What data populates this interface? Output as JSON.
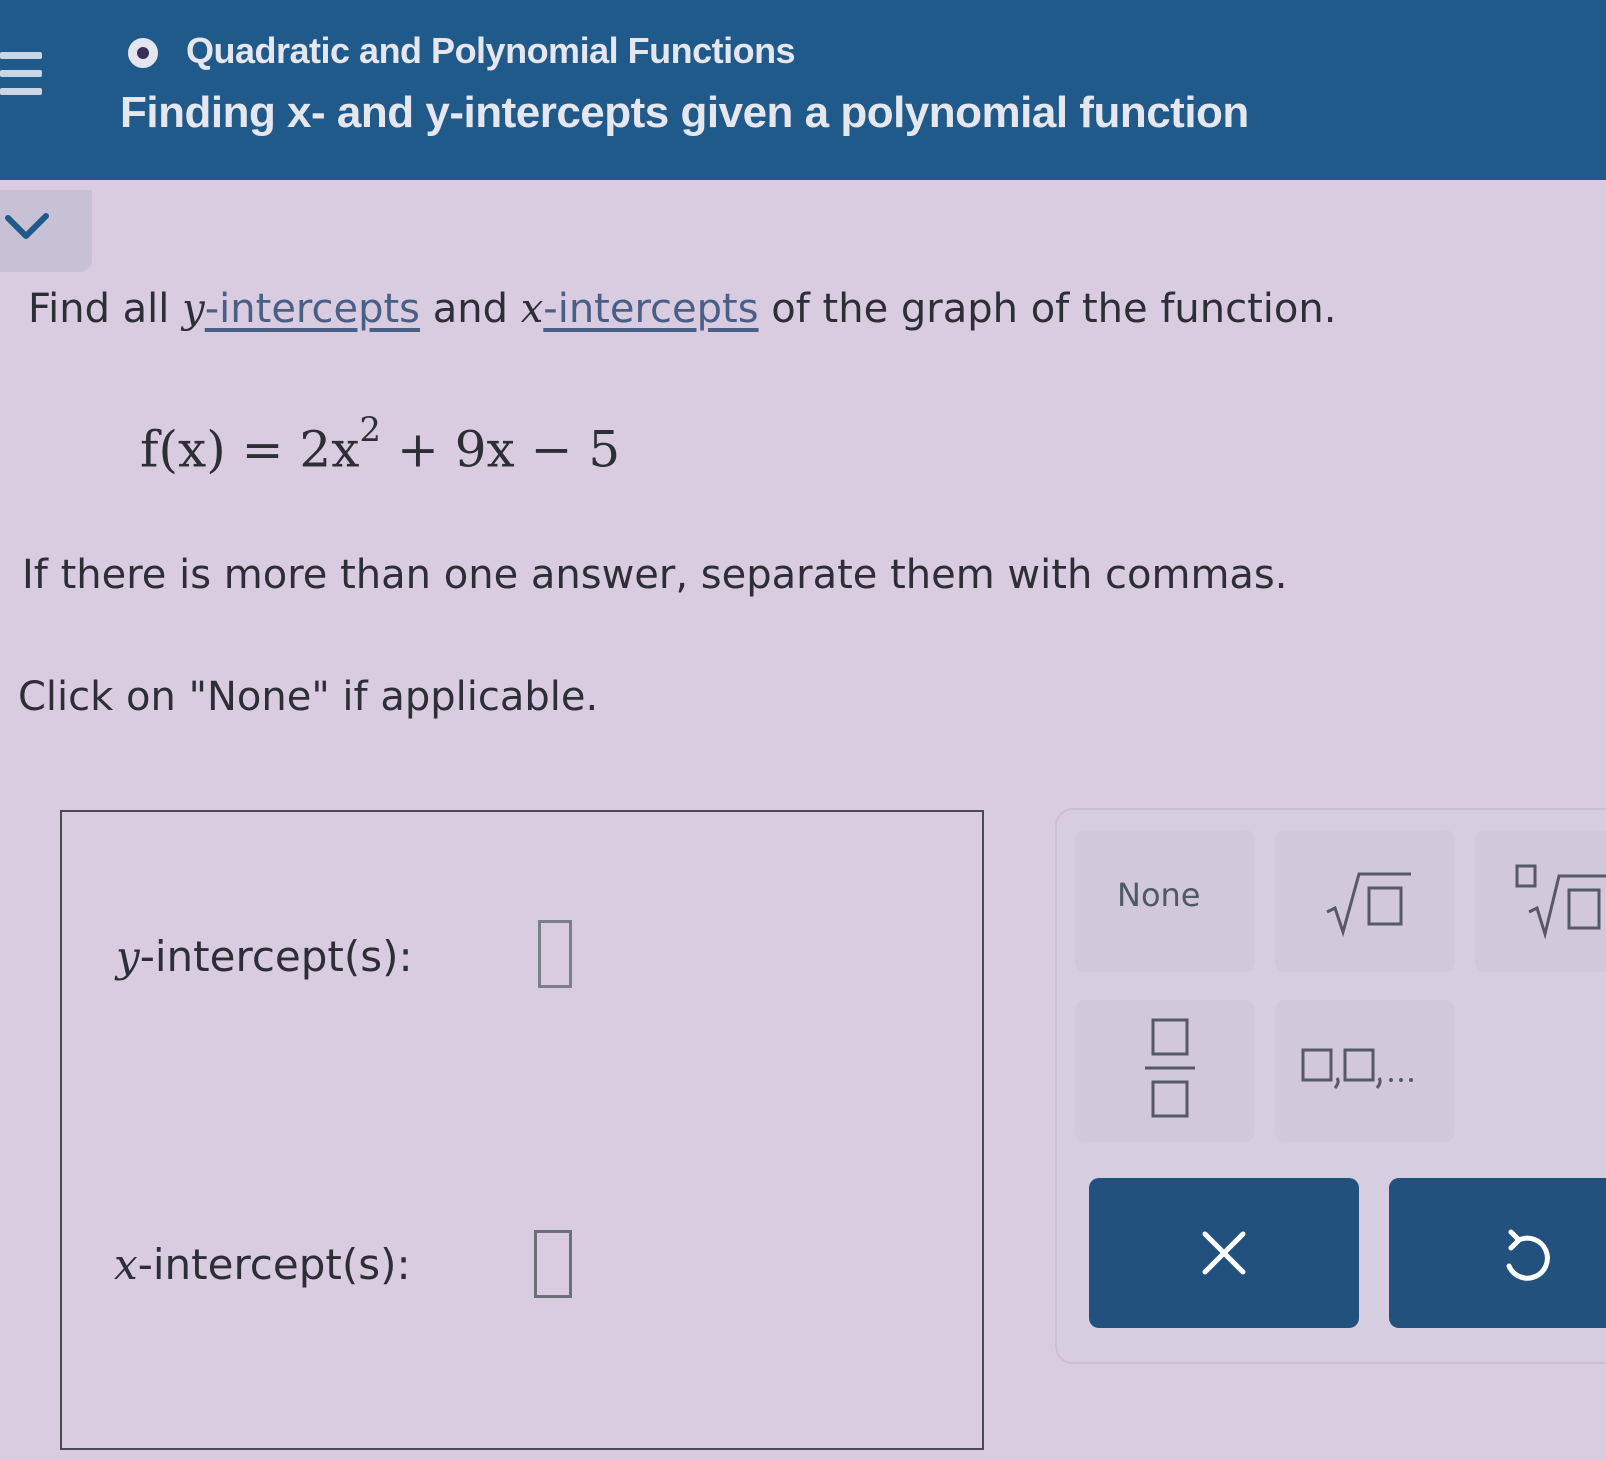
{
  "header": {
    "topic": "Quadratic and Polynomial Functions",
    "lesson": "Finding x- and y-intercepts given a polynomial function",
    "background_color": "#1f5a8a"
  },
  "question": {
    "line1": {
      "prefix": "Find all ",
      "var_y": "y",
      "link_y": "-intercepts",
      "mid": " and ",
      "var_x": "x",
      "link_x": "-intercepts",
      "suffix": " of the graph of the function."
    },
    "formula": {
      "lhs": "f(x) = 2x",
      "exponent": "2",
      "rhs": " + 9x − 5"
    },
    "instruction1": "If there is more than one answer, separate them with commas.",
    "instruction2": "Click on \"None\" if applicable."
  },
  "answers": {
    "y_var": "y",
    "y_label": "-intercept(s):",
    "y_value": "",
    "x_var": "x",
    "x_label": "-intercept(s):",
    "x_value": ""
  },
  "keypad": {
    "none_label": "None",
    "sqrt_icon": "square-root-icon",
    "nth_root_icon": "nth-root-icon",
    "fraction_icon": "fraction-icon",
    "list_icon": "comma-list-icon",
    "clear_icon": "clear-x-icon",
    "undo_icon": "undo-icon",
    "action_color": "#22517d"
  }
}
